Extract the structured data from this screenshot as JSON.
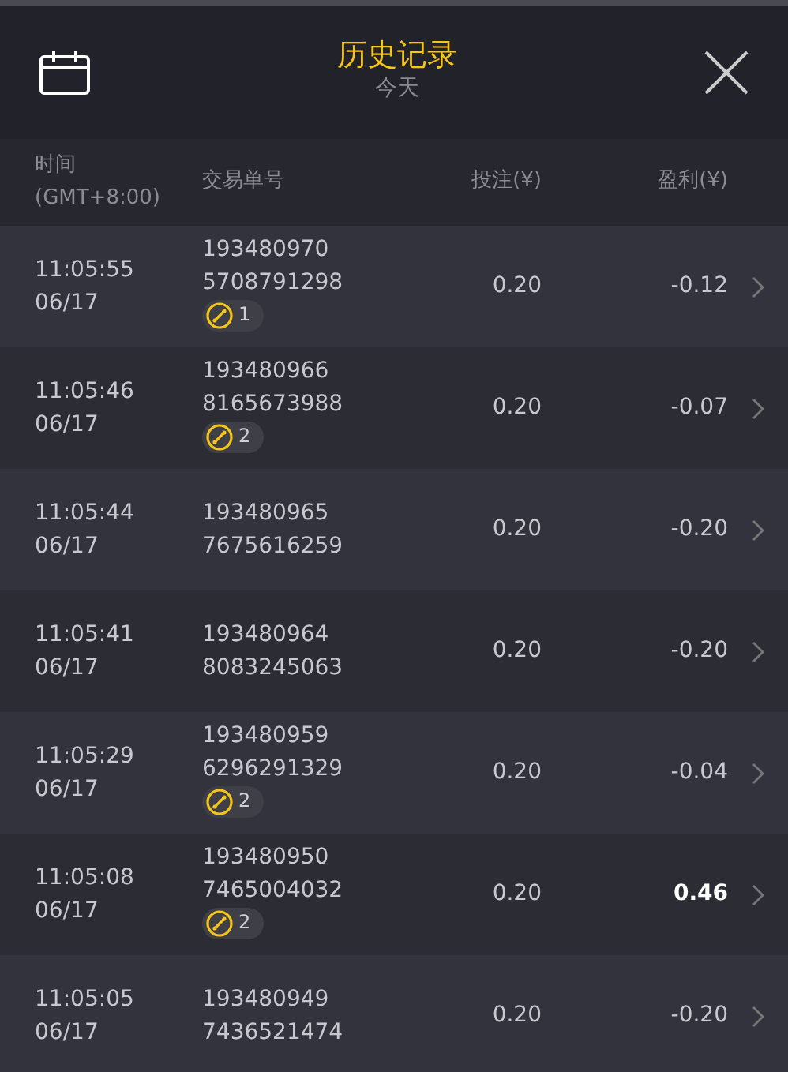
{
  "header": {
    "title": "历史记录",
    "subtitle": "今天"
  },
  "columns": [
    "时间\n(GMT+8:00)",
    "交易单号",
    "投注(¥)",
    "盈利(¥)"
  ],
  "rows": [
    {
      "time": "11:05:55",
      "date": "06/17",
      "order_1": "193480970",
      "order_2": "5708791298",
      "badge": "1",
      "stake": "0.20",
      "profit": "-0.12",
      "win": false
    },
    {
      "time": "11:05:46",
      "date": "06/17",
      "order_1": "193480966",
      "order_2": "8165673988",
      "badge": "2",
      "stake": "0.20",
      "profit": "-0.07",
      "win": false
    },
    {
      "time": "11:05:44",
      "date": "06/17",
      "order_1": "193480965",
      "order_2": "7675616259",
      "stake": "0.20",
      "profit": "-0.20",
      "win": false
    },
    {
      "time": "11:05:41",
      "date": "06/17",
      "order_1": "193480964",
      "order_2": "8083245063",
      "stake": "0.20",
      "profit": "-0.20",
      "win": false
    },
    {
      "time": "11:05:29",
      "date": "06/17",
      "order_1": "193480959",
      "order_2": "6296291329",
      "badge": "2",
      "stake": "0.20",
      "profit": "-0.04",
      "win": false
    },
    {
      "time": "11:05:08",
      "date": "06/17",
      "order_1": "193480950",
      "order_2": "7465004032",
      "badge": "2",
      "stake": "0.20",
      "profit": "0.46",
      "win": true
    },
    {
      "time": "11:05:05",
      "date": "06/17",
      "order_1": "193480949",
      "order_2": "7436521474",
      "stake": "0.20",
      "profit": "-0.20",
      "win": false
    }
  ]
}
